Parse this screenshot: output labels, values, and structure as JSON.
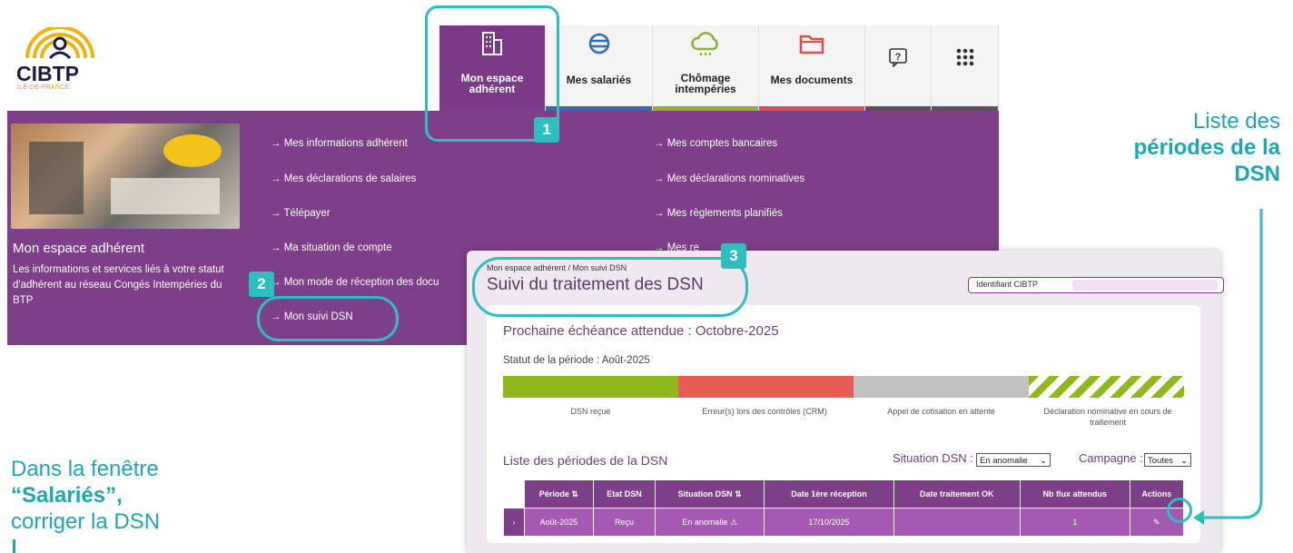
{
  "logo": {
    "name": "CIBTP",
    "region": "ILE-DE-FRANCE"
  },
  "tabs": [
    {
      "label_line1": "Mon espace",
      "label_line2": "adhérent",
      "icon": "building-icon",
      "bar_color": "#7b3a87"
    },
    {
      "label_line1": "Mes salariés",
      "label_line2": "",
      "icon": "people-icon",
      "bar_color": "#2b6fb5"
    },
    {
      "label_line1": "Chômage",
      "label_line2": "intempéries",
      "icon": "cloud-rain-icon",
      "bar_color": "#8ab52f"
    },
    {
      "label_line1": "Mes documents",
      "label_line2": "",
      "icon": "folder-icon",
      "bar_color": "#e44b4b"
    },
    {
      "label_line1": "",
      "label_line2": "",
      "icon": "help-chat-icon",
      "bar_color": "#555555"
    },
    {
      "label_line1": "",
      "label_line2": "",
      "icon": "grid-apps-icon",
      "bar_color": "#555555"
    }
  ],
  "menu": {
    "title": "Mon espace adhérent",
    "description": "Les informations et services liés à votre statut d'adhérent au réseau Congés Intempéries du BTP",
    "left_items": [
      "→ Mes informations adhérent",
      "→ Mes déclarations de salaires",
      "→ Télépayer",
      "→ Ma situation de compte",
      "→ Mon mode de réception des docu",
      "→ Mon suivi DSN"
    ],
    "right_items": [
      "→ Mes comptes bancaires",
      "→ Mes déclarations nominatives",
      "→ Mes règlements planifiés",
      "→ Mes re"
    ]
  },
  "dsn": {
    "breadcrumb": "Mon espace adhérent / Mon suivi DSN",
    "title": "Suivi du traitement des DSN",
    "identifiant_label": "Identifiant CIBTP",
    "next_deadline": "Prochaine échéance attendue : Octobre-2025",
    "period_status": "Statut de la période : Août-2025",
    "status_bar": [
      {
        "label": "DSN reçue",
        "color": "#8fb81c"
      },
      {
        "label": "Erreur(s) lors des contrôles (CRM)",
        "color": "#e95b55"
      },
      {
        "label": "Appel de cotisation en attente",
        "color": "#c2c2c2"
      },
      {
        "label": "Déclaration nominative en cours de traitement",
        "color": "#8fb81c"
      }
    ],
    "list_title": "Liste des périodes de la DSN",
    "filter_situation_label": "Situation DSN :",
    "filter_situation_value": "En anomalie",
    "filter_campagne_label": "Campagne :",
    "filter_campagne_value": "Toutes",
    "table": {
      "headers": [
        "Période",
        "Etat DSN",
        "Situation DSN",
        "Date 1ère réception",
        "Date traitement OK",
        "Nb flux attendus",
        "Actions"
      ],
      "rows": [
        [
          "Août-2025",
          "Reçu",
          "En anomalie",
          "17/10/2025",
          "",
          "1",
          ""
        ]
      ]
    }
  },
  "annotations": {
    "badge1": "1",
    "badge2": "2",
    "badge3": "3",
    "note_right_1": "Liste des",
    "note_right_2": "périodes de la",
    "note_right_3": "DSN",
    "note_left_1": "Dans la fenêtre",
    "note_left_2": "“Salariés”,",
    "note_left_3": "corriger la DSN"
  },
  "colors": {
    "accent_purple": "#7d3f88",
    "callout_teal": "#2fbdbd"
  }
}
